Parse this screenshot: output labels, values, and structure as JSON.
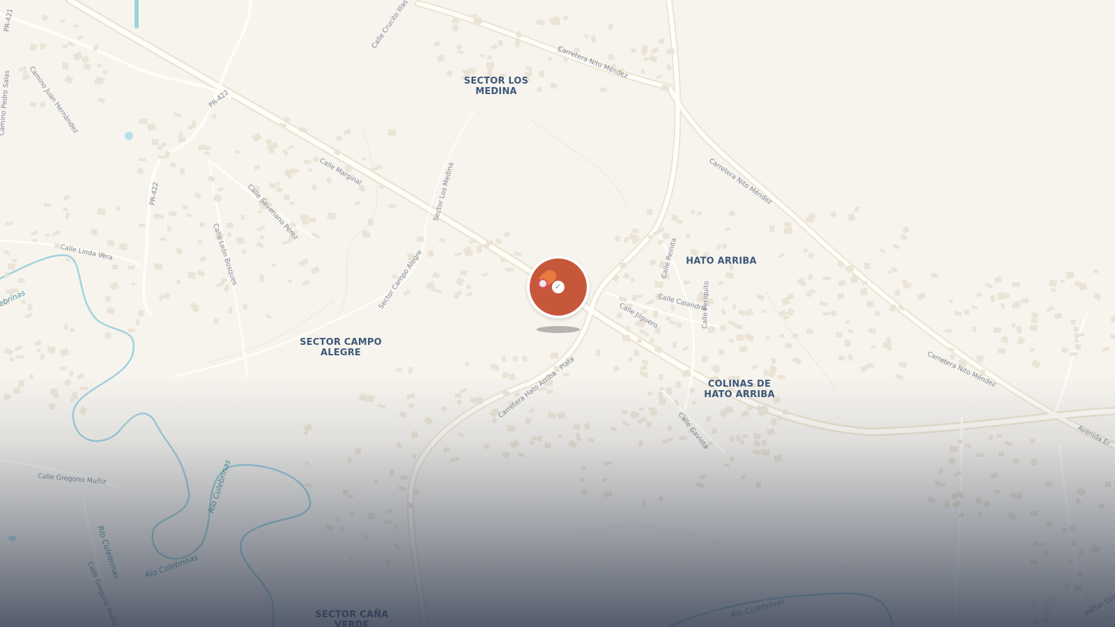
{
  "map": {
    "colors": {
      "land": "#f7f4ee",
      "road": "#fffdf7",
      "road_edge": "#ece4d2",
      "building": "#ebe4d6",
      "water": "#9fd2df",
      "water_label": "#4f9aa8",
      "district_label": "#3d5878",
      "street_label": "#7d8794",
      "marker": "#c7573a"
    },
    "districts": [
      {
        "line1": "SECTOR LOS",
        "line2": "MEDINA"
      },
      {
        "line1": "HATO ARRIBA",
        "line2": ""
      },
      {
        "line1": "SECTOR CAMPO",
        "line2": "ALEGRE"
      },
      {
        "line1": "COLINAS DE",
        "line2": "HATO ARRIBA"
      },
      {
        "line1": "SECTOR CAÑA",
        "line2": "VERDE"
      }
    ],
    "streets": [
      "PR-421",
      "Calle Crucito Illas",
      "Carretera Nito Méndez",
      "Camino Pedro Salas",
      "Camino Juan Hernández",
      "PR-422",
      "Carretera Nito Méndez",
      "Calle Marginal",
      "PR-422",
      "Calle Severiano Pérez",
      "Sector Los Medina",
      "Calle León Bosques",
      "Calle Linda Vera",
      "Sector Campo Alegre",
      "Calle Reinita",
      "Calle Calandria",
      "Calle Periquito",
      "Calle Jilguero",
      "Carretera Hato Arriba - Plata",
      "Carretera Nito Méndez",
      "Calle Gaviota",
      "Avenida Er",
      "Calle Gregorio Muñiz",
      "Calle Gregorio Muñiz",
      "Sector Colo"
    ],
    "water_labels": [
      "Río Culebrinas",
      "Río Culebrinas",
      "Río Culebrinas",
      "Río Culebrinas",
      "ebrinas"
    ],
    "marker": {
      "icon": "location-pin-icon",
      "tick": "✓"
    }
  }
}
